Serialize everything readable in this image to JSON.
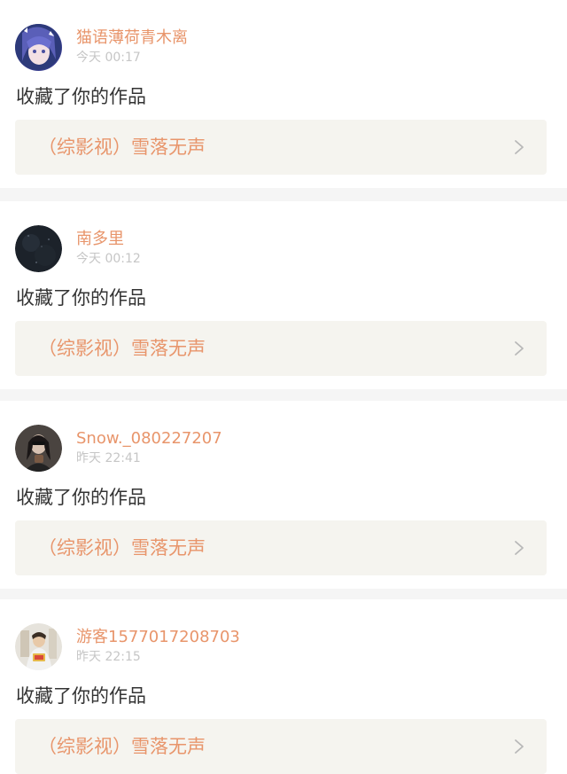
{
  "colors": {
    "accent": "#e8956b",
    "muted": "#c6c6c6",
    "text": "#333333",
    "card_bg": "#f5f4ef",
    "divider": "#f5f5f5"
  },
  "notifications": [
    {
      "username": "猫语薄荷青木离",
      "timestamp": "今天 00:17",
      "action": "收藏了你的作品",
      "work_title": "（综影视）雪落无声",
      "avatar_icon": "avatar-anime-girl-icon"
    },
    {
      "username": "南多里",
      "timestamp": "今天 00:12",
      "action": "收藏了你的作品",
      "work_title": "（综影视）雪落无声",
      "avatar_icon": "avatar-dark-icon"
    },
    {
      "username": "Snow._080227207",
      "timestamp": "昨天 22:41",
      "action": "收藏了你的作品",
      "work_title": "（综影视）雪落无声",
      "avatar_icon": "avatar-person-icon"
    },
    {
      "username": "游客1577017208703",
      "timestamp": "昨天 22:15",
      "action": "收藏了你的作品",
      "work_title": "（综影视）雪落无声",
      "avatar_icon": "avatar-guest-icon"
    }
  ]
}
